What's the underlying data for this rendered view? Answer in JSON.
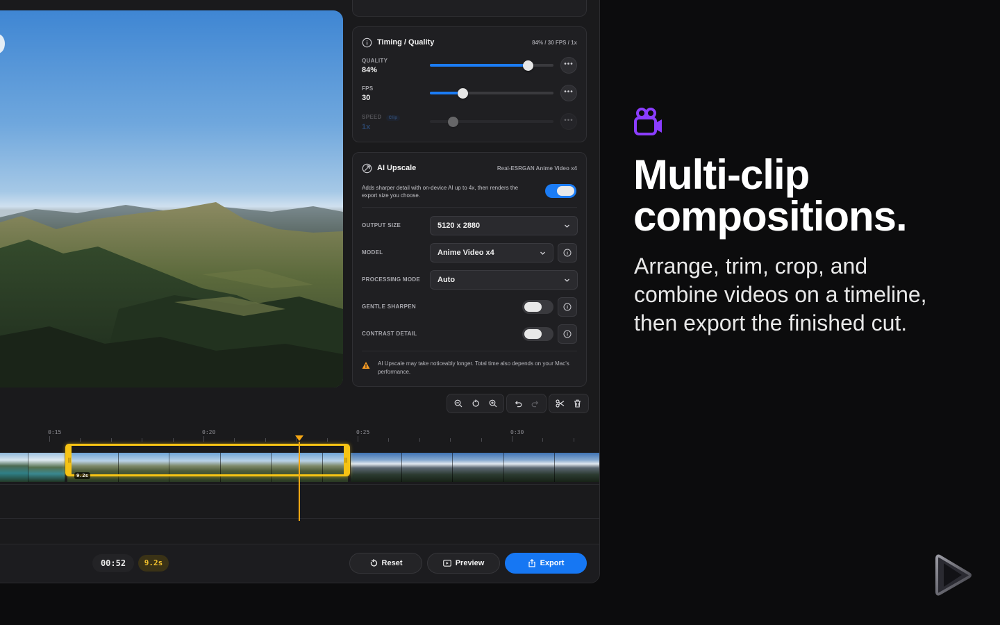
{
  "timing_card": {
    "title": "Timing / Quality",
    "meta": "84% / 30 FPS / 1x",
    "quality": {
      "label": "QUALITY",
      "value": "84%",
      "level": 0.84
    },
    "fps": {
      "label": "FPS",
      "value": "30",
      "level": 0.27
    },
    "speed": {
      "label": "SPEED",
      "badge": "Clip",
      "value": "1x",
      "level": 0.19,
      "disabled": true
    },
    "more_glyph": "•••"
  },
  "upscale_card": {
    "title": "AI Upscale",
    "meta": "Real-ESRGAN Anime Video x4",
    "description": "Adds sharper detail with on-device AI up to 4x, then renders the export size you choose.",
    "enabled": true,
    "output_size": {
      "label": "OUTPUT SIZE",
      "value": "5120 x 2880"
    },
    "model": {
      "label": "MODEL",
      "value": "Anime Video x4"
    },
    "processing_mode": {
      "label": "PROCESSING MODE",
      "value": "Auto"
    },
    "gentle_sharpen": {
      "label": "GENTLE SHARPEN",
      "enabled": false
    },
    "contrast_detail": {
      "label": "CONTRAST DETAIL",
      "enabled": false
    },
    "warning": "AI Upscale may take noticeably longer. Total time also depends on your Mac's performance."
  },
  "timeline": {
    "ticks": [
      "0:15",
      "0:20",
      "0:25",
      "0:30"
    ],
    "selected_clip_duration": "9.2s"
  },
  "bottom_bar": {
    "timecode": "00:52",
    "duration": "9.2s",
    "reset_label": "Reset",
    "preview_label": "Preview",
    "export_label": "Export"
  },
  "marketing": {
    "headline_line1": "Multi-clip",
    "headline_line2": "compositions.",
    "subcopy": "Arrange, trim, crop, and combine videos on a timeline, then export the finished cut."
  },
  "colors": {
    "accent_blue": "#1677f3",
    "selection_yellow": "#f6c314",
    "playhead_orange": "#f6a714",
    "feature_icon_purple": "#8b3dff"
  },
  "icons": [
    "info-icon",
    "upscale-icon",
    "chevron-down-icon",
    "warning-icon",
    "zoom-out-icon",
    "reset-zoom-icon",
    "zoom-in-icon",
    "undo-icon",
    "redo-icon",
    "scissors-icon",
    "trash-icon",
    "reset-icon",
    "preview-icon",
    "export-icon",
    "video-camera-icon",
    "play-logo-icon"
  ]
}
